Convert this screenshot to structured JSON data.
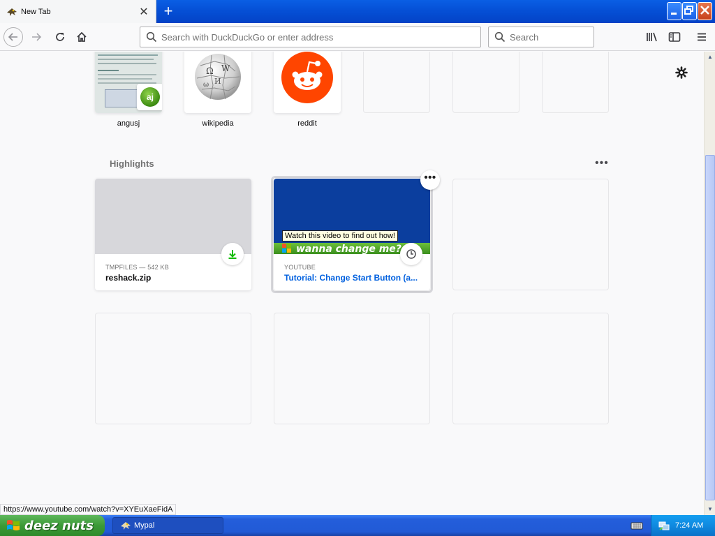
{
  "browser": {
    "tab_title": "New Tab",
    "url_placeholder": "Search with DuckDuckGo or enter address",
    "search_placeholder": "Search"
  },
  "top_sites": [
    {
      "label": "angusj",
      "badge": "aj"
    },
    {
      "label": "wikipedia"
    },
    {
      "label": "reddit"
    }
  ],
  "highlights": {
    "title": "Highlights",
    "cards": [
      {
        "source": "TMPFILES — 542 KB",
        "title": "reshack.zip",
        "badge_icon": "download-icon"
      },
      {
        "source": "YOUTUBE",
        "title": "Tutorial: Change Start Button (a...",
        "badge_icon": "clock-icon",
        "thumb_tooltip": "Watch this video to find out how!",
        "thumb_banner": "wanna change me?"
      }
    ]
  },
  "status_url": "https://www.youtube.com/watch?v=XYEuXaeFidA",
  "taskbar": {
    "start_label": "deez nuts",
    "task_label": "Mypal",
    "clock": "7:24 AM"
  },
  "colors": {
    "link_blue": "#0060df",
    "reddit_orange": "#ff4500",
    "download_green": "#12bc00",
    "xp_blue": "#245edb"
  }
}
